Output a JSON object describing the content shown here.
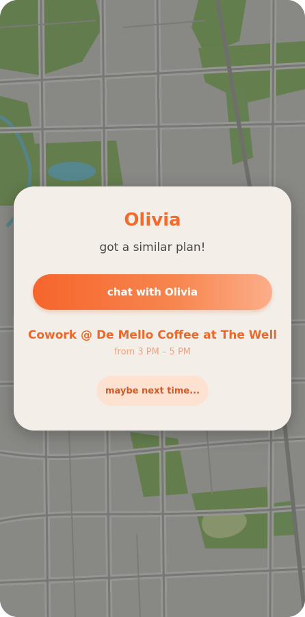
{
  "match": {
    "name": "Olivia",
    "subtitle": "got a similar plan!",
    "chat_button_label": "chat with Olivia",
    "event_title": "Cowork @ De Mello Coffee at The Well",
    "event_time": "from 3 PM – 5 PM",
    "dismiss_button_label": "maybe next time..."
  },
  "colors": {
    "accent": "#f26b2e",
    "card_background": "#f3efe8",
    "dismiss_background": "#fde2d2"
  }
}
